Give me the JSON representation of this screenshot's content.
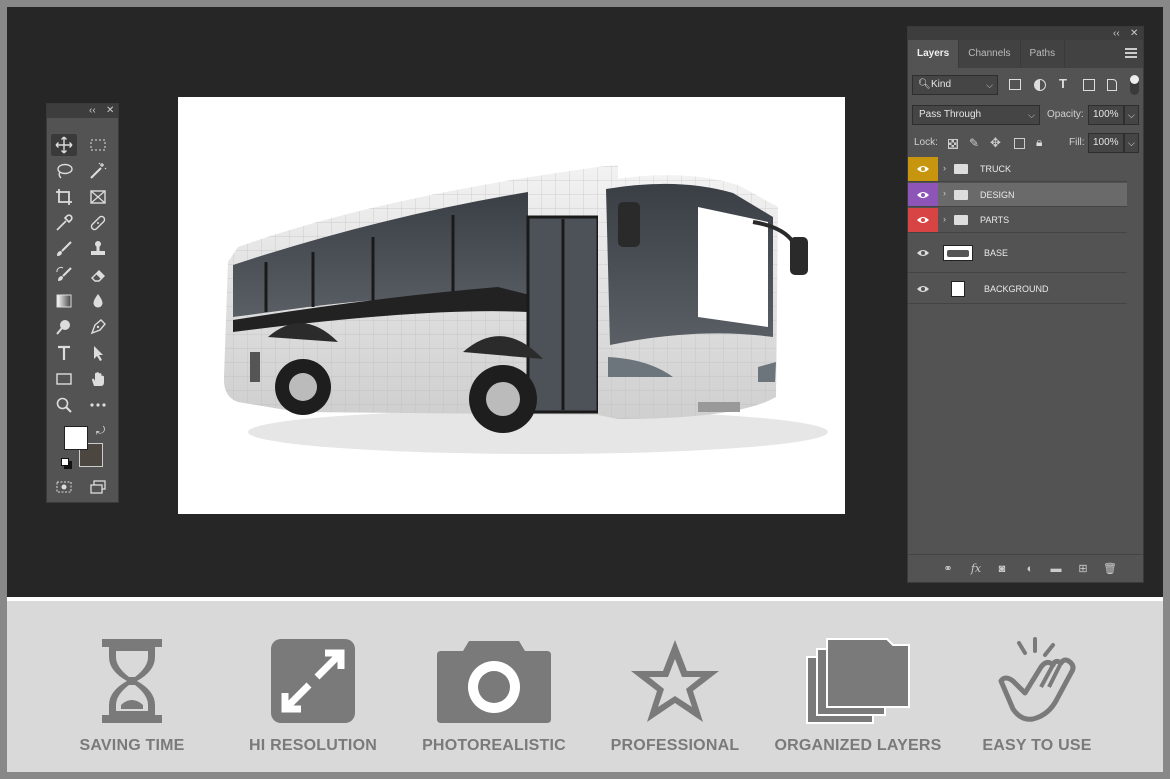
{
  "layers_panel": {
    "tabs": [
      "Layers",
      "Channels",
      "Paths"
    ],
    "kind_filter": "Kind",
    "blend_mode": "Pass Through",
    "opacity_label": "Opacity:",
    "opacity_value": "100%",
    "lock_label": "Lock:",
    "fill_label": "Fill:",
    "fill_value": "100%",
    "layers": [
      {
        "name": "TRUCK",
        "type": "group",
        "color": "#c8950f"
      },
      {
        "name": "DESIGN",
        "type": "group",
        "color": "#8e55b8",
        "selected": true
      },
      {
        "name": "PARTS",
        "type": "group",
        "color": "#d84343"
      },
      {
        "name": "BASE",
        "type": "image"
      },
      {
        "name": "BACKGROUND",
        "type": "fill"
      }
    ],
    "footer_icons": [
      "link-icon",
      "fx-icon",
      "mask-icon",
      "adjustment-icon",
      "folder-icon",
      "new-layer-icon",
      "trash-icon"
    ]
  },
  "toolbox": {
    "tools": [
      "move-tool",
      "marquee-tool",
      "lasso-tool",
      "magic-wand-tool",
      "crop-tool",
      "frame-tool",
      "eyedropper-tool",
      "healing-tool",
      "brush-tool",
      "stamp-tool",
      "history-brush-tool",
      "eraser-tool",
      "gradient-tool",
      "blur-tool",
      "dodge-tool",
      "pen-tool",
      "type-tool",
      "path-selection-tool",
      "rectangle-tool",
      "hand-tool",
      "zoom-tool",
      "more-tools"
    ],
    "foreground_color": "#ffffff",
    "background_color": "#4b463f"
  },
  "canvas": {
    "subject": "coach bus mockup"
  },
  "features": [
    {
      "label": "SAVING TIME",
      "icon": "hourglass-icon"
    },
    {
      "label": "HI RESOLUTION",
      "icon": "expand-icon"
    },
    {
      "label": "PHOTOREALISTIC",
      "icon": "camera-icon"
    },
    {
      "label": "PROFESSIONAL",
      "icon": "star-icon"
    },
    {
      "label": "ORGANIZED LAYERS",
      "icon": "layers-icon"
    },
    {
      "label": "EASY TO USE",
      "icon": "hand-click-icon"
    }
  ]
}
